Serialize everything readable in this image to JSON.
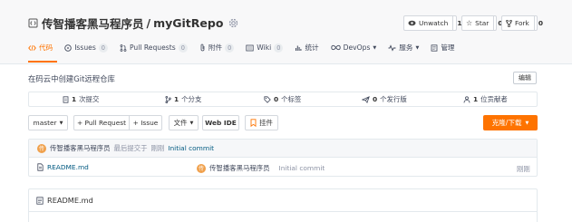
{
  "repo": {
    "owner": "传智播客黑马程序员",
    "separator": "/",
    "name": "myGitRepo",
    "watch_label": "Unwatch",
    "watch_count": "1",
    "star_label": "Star",
    "star_count": "0",
    "fork_label": "Fork",
    "fork_count": "0"
  },
  "tabs": [
    {
      "label": "代码",
      "icon": "code-icon",
      "active": true
    },
    {
      "label": "Issues",
      "badge": "0",
      "icon": "issue-icon"
    },
    {
      "label": "Pull Requests",
      "badge": "0",
      "icon": "pull-request-icon"
    },
    {
      "label": "附件",
      "badge": "0",
      "icon": "attachment-icon"
    },
    {
      "label": "Wiki",
      "badge": "0",
      "icon": "wiki-icon"
    },
    {
      "label": "统计",
      "icon": "chart-icon"
    },
    {
      "label": "DevOps",
      "icon": "devops-icon",
      "dropdown": true
    },
    {
      "label": "服务",
      "icon": "service-icon",
      "dropdown": true
    },
    {
      "label": "管理",
      "icon": "manage-icon"
    }
  ],
  "description": {
    "text": "在码云中创建Git远程仓库",
    "edit_label": "编辑"
  },
  "stats": {
    "commits_count": "1",
    "commits_label": "次提交",
    "branches_count": "1",
    "branches_label": "个分支",
    "tags_count": "0",
    "tags_label": "个标签",
    "releases_count": "0",
    "releases_label": "个发行版",
    "contributors_count": "1",
    "contributors_label": "位贡献者"
  },
  "toolbar": {
    "branch": "master",
    "pull_request": "+ Pull Request",
    "issue": "+ Issue",
    "files": "文件",
    "webide": "Web IDE",
    "mount": "挂件",
    "clone": "克隆/下载"
  },
  "commit": {
    "author": "传智播客黑马程序员",
    "meta": "最后提交于",
    "time": "刚刚",
    "message": "Initial commit"
  },
  "files": [
    {
      "name": "README.md",
      "author": "传智播客黑马程序员",
      "message": "Initial commit",
      "time": "刚刚"
    }
  ],
  "readme": {
    "title": "README.md"
  },
  "colors": {
    "accent": "#fe7300",
    "link": "#005980"
  }
}
